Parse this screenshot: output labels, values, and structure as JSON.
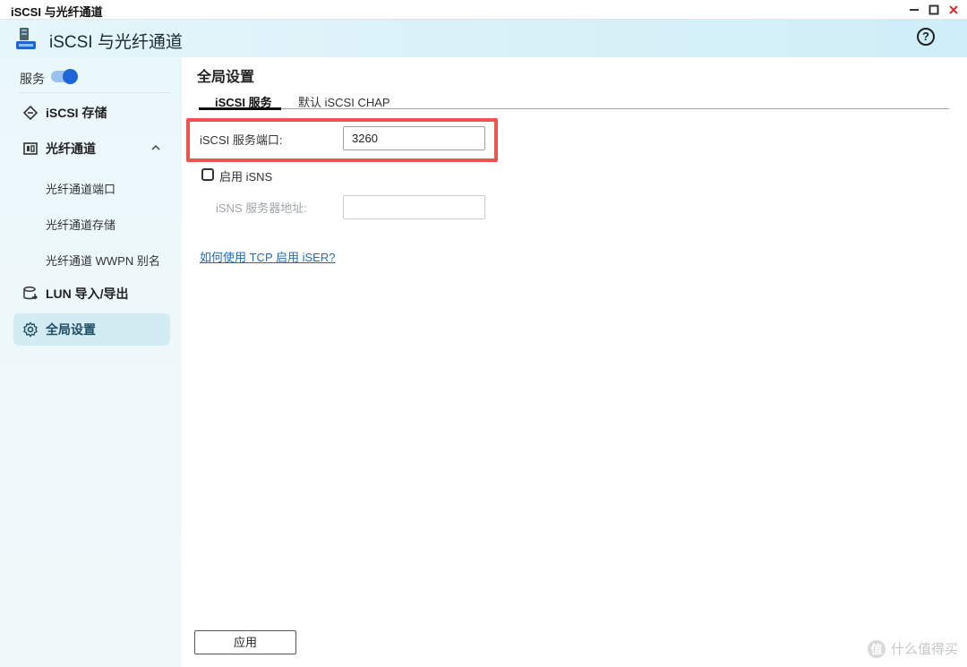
{
  "window": {
    "title": "iSCSI 与光纤通道",
    "controls": [
      "minimize-icon",
      "maximize-icon",
      "close-icon"
    ]
  },
  "header": {
    "app_title": "iSCSI 与光纤通道",
    "help_glyph": "?"
  },
  "sidebar": {
    "service_label": "服务",
    "service_enabled": true,
    "items": [
      {
        "label": "iSCSI 存储",
        "icon": "iscsi-storage-icon"
      },
      {
        "label": "光纤通道",
        "icon": "fibre-channel-icon",
        "expanded": true,
        "children": [
          "光纤通道端口",
          "光纤通道存储",
          "光纤通道 WWPN 别名"
        ]
      },
      {
        "label": "LUN 导入/导出",
        "icon": "lun-import-export-icon"
      },
      {
        "label": "全局设置",
        "icon": "settings-gear-icon",
        "active": true
      }
    ]
  },
  "main": {
    "page_title": "全局设置",
    "tabs": [
      {
        "label": "iSCSI 服务",
        "active": true
      },
      {
        "label": "默认 iSCSI CHAP",
        "active": false
      }
    ],
    "port_label": "iSCSI 服务端口:",
    "port_value": "3260",
    "isns_checkbox_label": "启用 iSNS",
    "isns_checked": false,
    "isns_server_label": "iSNS 服务器地址:",
    "isns_server_value": "",
    "iser_link": "如何使用 TCP 启用 iSER?",
    "apply_label": "应用"
  },
  "watermark": {
    "text": "什么值得买",
    "badge": "值"
  },
  "colors": {
    "accent": "#1d66d8",
    "highlight": "#ef5350",
    "link": "#1e6bb8",
    "active_nav_bg": "#d3ecf4"
  }
}
